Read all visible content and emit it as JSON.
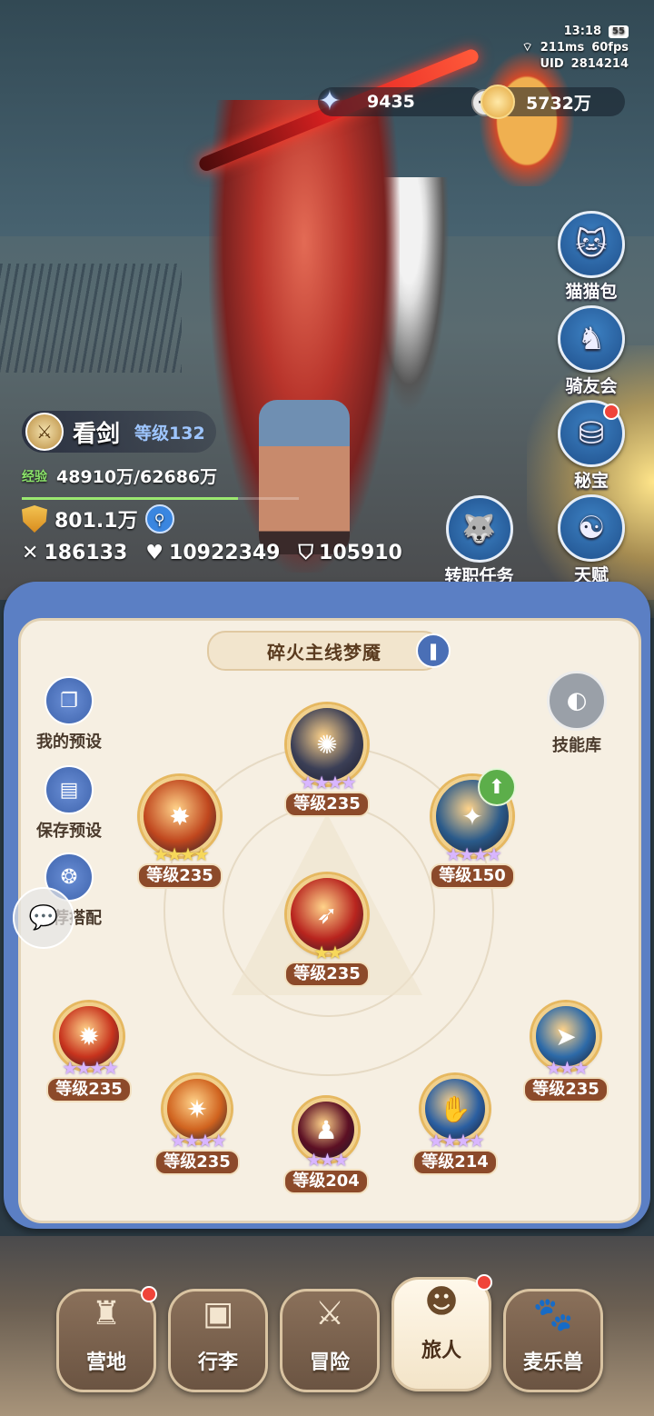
{
  "status": {
    "time": "13:18",
    "battery": "55",
    "ping": "211ms",
    "fps": "60fps",
    "uid_label": "UID",
    "uid": "2814214"
  },
  "currency": {
    "gems": "9435",
    "coins": "5732万"
  },
  "side_menu": [
    {
      "label": "猫猫包",
      "icon": "cat-bag-icon"
    },
    {
      "label": "骑友会",
      "icon": "horse-icon"
    },
    {
      "label": "秘宝",
      "icon": "treasure-icon"
    },
    {
      "label": "天赋",
      "icon": "brain-icon"
    }
  ],
  "player": {
    "name": "看剑",
    "level": "等级132",
    "exp_label": "经验",
    "exp": "48910万/62686万",
    "exp_fraction": 0.78,
    "power": "801.1万",
    "attack": "186133",
    "hp": "10922349",
    "defense": "105910"
  },
  "job_task": "转职任务",
  "panel": {
    "title": "碎火主线梦魇",
    "left_buttons": [
      "我的预设",
      "保存预设",
      "推荐搭配"
    ],
    "skill_library": "技能库"
  },
  "skills": [
    {
      "level": "等级235",
      "stars": "★★★★",
      "star_color": "purple",
      "orb": "#3b3f56"
    },
    {
      "level": "等级235",
      "stars": "★★★★",
      "star_color": "gold",
      "orb": "#c0471e"
    },
    {
      "level": "等级150",
      "stars": "★★★★",
      "star_color": "purple",
      "orb": "#2a5a8a"
    },
    {
      "level": "等级235",
      "stars": "★★",
      "star_color": "gold",
      "orb": "#b8241e"
    },
    {
      "level": "等级235",
      "stars": "★★★★",
      "star_color": "purple",
      "orb": "#c7331d"
    },
    {
      "level": "等级235",
      "stars": "★★★",
      "star_color": "purple",
      "orb": "#2d6aa8"
    },
    {
      "level": "等级235",
      "stars": "★★★★",
      "star_color": "purple",
      "orb": "#d0631f"
    },
    {
      "level": "等级204",
      "stars": "★★★",
      "star_color": "purple",
      "orb": "#5c1024"
    },
    {
      "level": "等级214",
      "stars": "★★★★",
      "star_color": "purple",
      "orb": "#2b5fa1"
    }
  ],
  "nav": [
    {
      "label": "营地",
      "icon": "castle-icon",
      "badge": true
    },
    {
      "label": "行李",
      "icon": "luggage-icon",
      "badge": false
    },
    {
      "label": "冒险",
      "icon": "crossed-swords-icon",
      "badge": false
    },
    {
      "label": "旅人",
      "icon": "traveler-icon",
      "badge": true,
      "active": true
    },
    {
      "label": "麦乐兽",
      "icon": "beast-icon",
      "badge": false
    }
  ]
}
